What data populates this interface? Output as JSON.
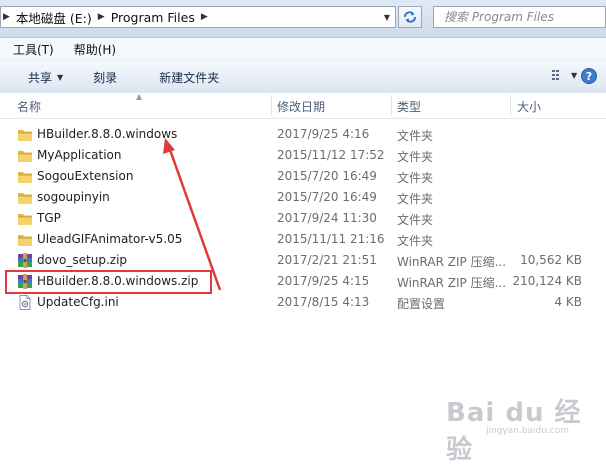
{
  "address_bar": {
    "breadcrumb": [
      "本地磁盘 (E:)",
      "Program Files"
    ],
    "search_placeholder": "搜索 Program Files"
  },
  "menu": [
    "工具(T)",
    "帮助(H)"
  ],
  "toolbar": {
    "share_label": "共享",
    "burn_label": "刻录",
    "new_folder_label": "新建文件夹"
  },
  "columns": {
    "name": "名称",
    "date": "修改日期",
    "type": "类型",
    "size": "大小"
  },
  "files": [
    {
      "name": "HBuilder.8.8.0.windows",
      "date": "2017/9/25 4:16",
      "type": "文件夹",
      "size": "",
      "icon": "folder-icon"
    },
    {
      "name": "MyApplication",
      "date": "2015/11/12 17:52",
      "type": "文件夹",
      "size": "",
      "icon": "folder-icon"
    },
    {
      "name": "SogouExtension",
      "date": "2015/7/20 16:49",
      "type": "文件夹",
      "size": "",
      "icon": "folder-icon"
    },
    {
      "name": "sogoupinyin",
      "date": "2015/7/20 16:49",
      "type": "文件夹",
      "size": "",
      "icon": "folder-icon"
    },
    {
      "name": "TGP",
      "date": "2017/9/24 11:30",
      "type": "文件夹",
      "size": "",
      "icon": "folder-icon"
    },
    {
      "name": "UleadGIFAnimator-v5.05",
      "date": "2015/11/11 21:16",
      "type": "文件夹",
      "size": "",
      "icon": "folder-icon"
    },
    {
      "name": "dovo_setup.zip",
      "date": "2017/2/21 21:51",
      "type": "WinRAR ZIP 压缩...",
      "size": "10,562 KB",
      "icon": "winrar-zip-icon"
    },
    {
      "name": "HBuilder.8.8.0.windows.zip",
      "date": "2017/9/25 4:15",
      "type": "WinRAR ZIP 压缩...",
      "size": "210,124 KB",
      "icon": "winrar-zip-icon"
    },
    {
      "name": "UpdateCfg.ini",
      "date": "2017/8/15 4:13",
      "type": "配置设置",
      "size": "4 KB",
      "icon": "ini-file-icon"
    }
  ],
  "annotation": {
    "color": "#e23a3a"
  },
  "watermark": {
    "text": "Bai du 经验",
    "sub": "jingyan.baidu.com"
  }
}
